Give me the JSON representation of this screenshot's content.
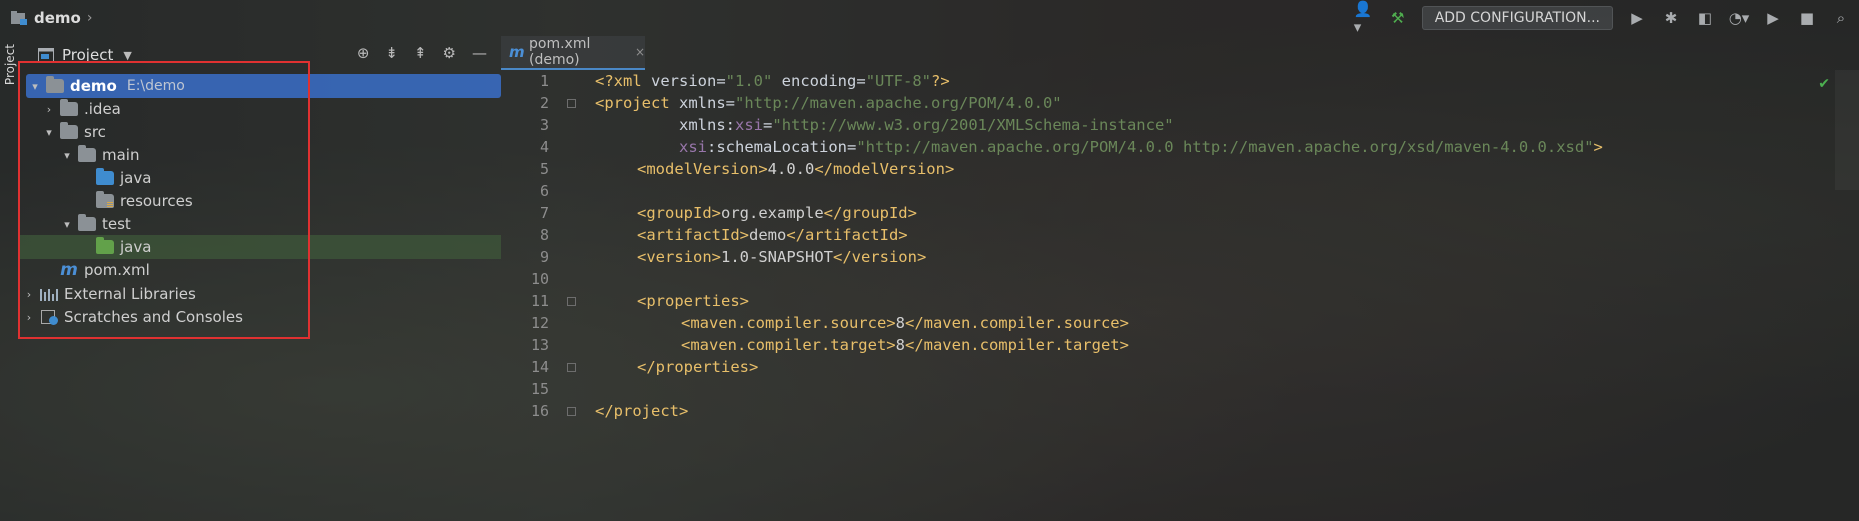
{
  "navbar": {
    "project_name": "demo",
    "run_config_label": "ADD CONFIGURATION...",
    "icons": [
      "user-menu-icon",
      "build-hammer-icon",
      "run-icon",
      "debug-icon",
      "coverage-icon",
      "profile-icon",
      "more-run-icon",
      "stop-disabled-icon",
      "stop-icon",
      "search-icon"
    ]
  },
  "left_strip": {
    "tab_label": "Project"
  },
  "project_panel": {
    "title": "Project",
    "tools": [
      "locate-icon",
      "expand-all-icon",
      "collapse-all-icon",
      "settings-icon",
      "minimize-icon"
    ],
    "tree": [
      {
        "label": "demo",
        "hint": "E:\\demo",
        "depth": 0,
        "arrow": "▾",
        "icon": "module-folder"
      },
      {
        "label": ".idea",
        "depth": 1,
        "arrow": "›",
        "icon": "folder"
      },
      {
        "label": "src",
        "depth": 1,
        "arrow": "▾",
        "icon": "folder"
      },
      {
        "label": "main",
        "depth": 2,
        "arrow": "▾",
        "icon": "folder"
      },
      {
        "label": "java",
        "depth": 3,
        "arrow": "",
        "icon": "source-folder"
      },
      {
        "label": "resources",
        "depth": 3,
        "arrow": "",
        "icon": "resources-folder"
      },
      {
        "label": "test",
        "depth": 2,
        "arrow": "▾",
        "icon": "folder"
      },
      {
        "label": "java",
        "depth": 3,
        "arrow": "",
        "icon": "test-folder"
      },
      {
        "label": "pom.xml",
        "depth": 1,
        "arrow": "",
        "icon": "maven"
      },
      {
        "label": "External Libraries",
        "depth": 0,
        "arrow": "›",
        "icon": "libraries"
      },
      {
        "label": "Scratches and Consoles",
        "depth": 0,
        "arrow": "›",
        "icon": "scratches"
      }
    ]
  },
  "editor": {
    "tab_label": "pom.xml (demo)",
    "tab_close": "×",
    "line_numbers": [
      "1",
      "2",
      "3",
      "4",
      "5",
      "6",
      "7",
      "8",
      "9",
      "10",
      "11",
      "12",
      "13",
      "14",
      "15",
      "16"
    ],
    "lines": {
      "l1": {
        "a": "<?xml ",
        "b": "version",
        "c": "=",
        "d": "\"1.0\"",
        "e": " encoding",
        "f": "=",
        "g": "\"UTF-8\"",
        "h": "?>"
      },
      "l2": {
        "a": "<project ",
        "b": "xmlns",
        "c": "=",
        "d": "\"http://maven.apache.org/POM/4.0.0\""
      },
      "l3": {
        "a": "xmlns",
        "b": ":",
        "c": "xsi",
        "d": "=",
        "e": "\"http://www.w3.org/2001/XMLSchema-instance\""
      },
      "l4": {
        "a": "xsi",
        "b": ":schemaLocation",
        "c": "=",
        "d": "\"http://maven.apache.org/POM/4.0.0 http://maven.apache.org/xsd/maven-4.0.0.xsd\"",
        "e": ">"
      },
      "l5": {
        "a": "<modelVersion>",
        "b": "4.0.0",
        "c": "</modelVersion>"
      },
      "l7": {
        "a": "<groupId>",
        "b": "org.example",
        "c": "</groupId>"
      },
      "l8": {
        "a": "<artifactId>",
        "b": "demo",
        "c": "</artifactId>"
      },
      "l9": {
        "a": "<version>",
        "b": "1.0-SNAPSHOT",
        "c": "</version>"
      },
      "l11": {
        "a": "<properties>"
      },
      "l12": {
        "a": "<maven.compiler.source>",
        "b": "8",
        "c": "</maven.compiler.source>"
      },
      "l13": {
        "a": "<maven.compiler.target>",
        "b": "8",
        "c": "</maven.compiler.target>"
      },
      "l14": {
        "a": "</properties>"
      },
      "l16": {
        "a": "</project>"
      }
    }
  },
  "colors": {
    "selection": "#3a6fc9",
    "highlight_box": "#e03131",
    "xml_tag": "#e8bf6a",
    "xml_value": "#6a8759"
  }
}
